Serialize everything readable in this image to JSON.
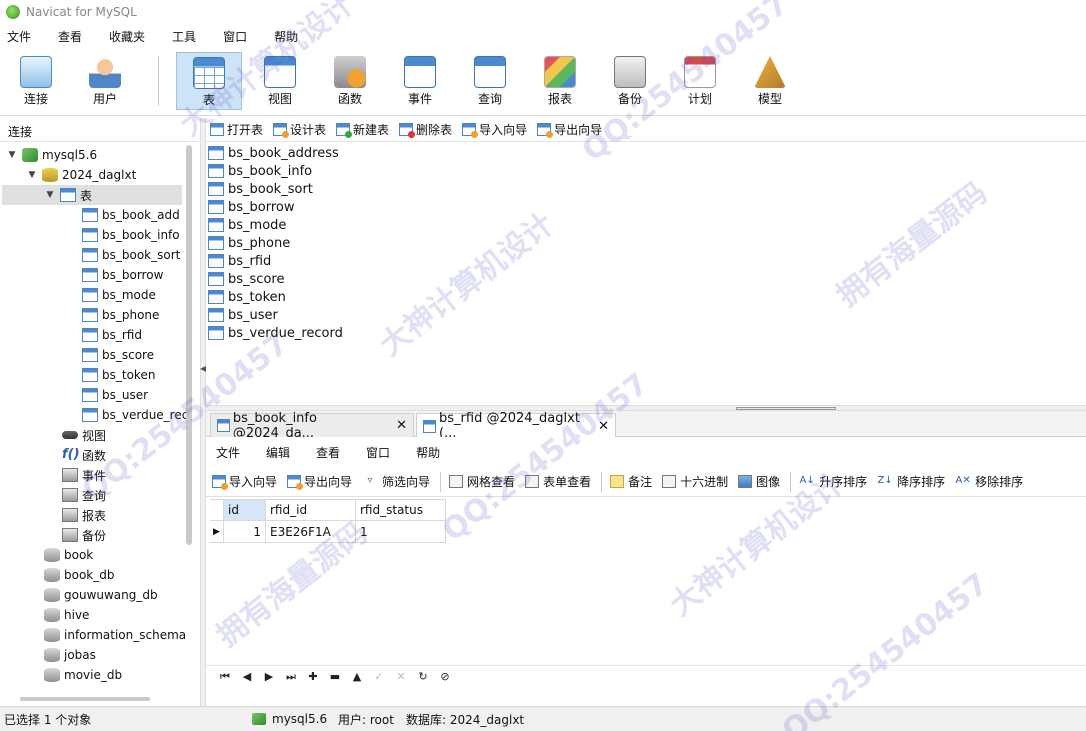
{
  "title": "Navicat for MySQL",
  "menu": [
    "文件",
    "查看",
    "收藏夹",
    "工具",
    "窗口",
    "帮助"
  ],
  "toolbar": [
    {
      "label": "连接",
      "icon": "connection-icon"
    },
    {
      "label": "用户",
      "icon": "user-icon"
    },
    {
      "label": "表",
      "icon": "table-icon",
      "active": true
    },
    {
      "label": "视图",
      "icon": "view-icon"
    },
    {
      "label": "函数",
      "icon": "function-icon"
    },
    {
      "label": "事件",
      "icon": "event-icon"
    },
    {
      "label": "查询",
      "icon": "query-icon"
    },
    {
      "label": "报表",
      "icon": "report-icon"
    },
    {
      "label": "备份",
      "icon": "backup-icon"
    },
    {
      "label": "计划",
      "icon": "schedule-icon"
    },
    {
      "label": "模型",
      "icon": "model-icon"
    }
  ],
  "connection_header": "连接",
  "tree": {
    "server": "mysql5.6",
    "database": "2024_daglxt",
    "tables_node": "表",
    "tables": [
      "bs_book_add",
      "bs_book_info",
      "bs_book_sort",
      "bs_borrow",
      "bs_mode",
      "bs_phone",
      "bs_rfid",
      "bs_score",
      "bs_token",
      "bs_user",
      "bs_verdue_rec"
    ],
    "other_nodes": [
      {
        "label": "视图",
        "icon": "view-icon"
      },
      {
        "label": "函数",
        "icon": "function-icon"
      },
      {
        "label": "事件",
        "icon": "event-icon"
      },
      {
        "label": "查询",
        "icon": "query-icon"
      },
      {
        "label": "报表",
        "icon": "report-icon"
      },
      {
        "label": "备份",
        "icon": "backup-icon"
      }
    ],
    "databases": [
      "book",
      "book_db",
      "gouwuwang_db",
      "hive",
      "information_schema",
      "jobas",
      "movie_db"
    ]
  },
  "object_toolbar": [
    "打开表",
    "设计表",
    "新建表",
    "删除表",
    "导入向导",
    "导出向导"
  ],
  "object_list": [
    "bs_book_address",
    "bs_book_info",
    "bs_book_sort",
    "bs_borrow",
    "bs_mode",
    "bs_phone",
    "bs_rfid",
    "bs_score",
    "bs_token",
    "bs_user",
    "bs_verdue_record"
  ],
  "tabs": [
    {
      "label": "bs_book_info @2024_da...",
      "active": false
    },
    {
      "label": "bs_rfid @2024_daglxt (...",
      "active": true
    }
  ],
  "inner_menu": [
    "文件",
    "编辑",
    "查看",
    "窗口",
    "帮助"
  ],
  "data_toolbar": [
    "导入向导",
    "导出向导",
    "筛选向导",
    "网格查看",
    "表单查看",
    "备注",
    "十六进制",
    "图像",
    "升序排序",
    "降序排序",
    "移除排序"
  ],
  "grid": {
    "columns": [
      "id",
      "rfid_id",
      "rfid_status"
    ],
    "rows": [
      {
        "id": "1",
        "rfid_id": "E3E26F1A",
        "rfid_status": "1"
      }
    ]
  },
  "status": {
    "selection": "已选择 1 个对象",
    "server": "mysql5.6",
    "user": "用户: root",
    "database": "数据库: 2024_daglxt"
  },
  "watermark": {
    "lines": [
      "大神计算机设计",
      "QQ:254540457",
      "拥有海量源码"
    ],
    "color": "#5050c8"
  }
}
